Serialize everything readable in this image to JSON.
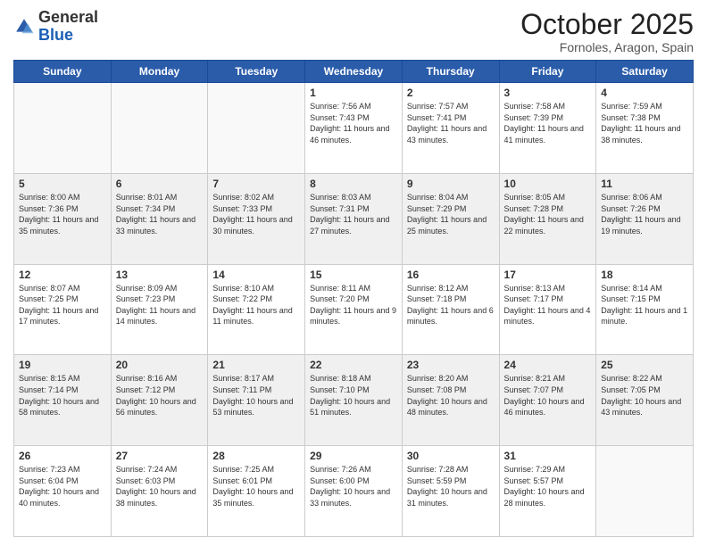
{
  "logo": {
    "general": "General",
    "blue": "Blue"
  },
  "header": {
    "month": "October 2025",
    "location": "Fornoles, Aragon, Spain"
  },
  "days_of_week": [
    "Sunday",
    "Monday",
    "Tuesday",
    "Wednesday",
    "Thursday",
    "Friday",
    "Saturday"
  ],
  "weeks": [
    [
      {
        "day": "",
        "sunrise": "",
        "sunset": "",
        "daylight": ""
      },
      {
        "day": "",
        "sunrise": "",
        "sunset": "",
        "daylight": ""
      },
      {
        "day": "",
        "sunrise": "",
        "sunset": "",
        "daylight": ""
      },
      {
        "day": "1",
        "sunrise": "Sunrise: 7:56 AM",
        "sunset": "Sunset: 7:43 PM",
        "daylight": "Daylight: 11 hours and 46 minutes."
      },
      {
        "day": "2",
        "sunrise": "Sunrise: 7:57 AM",
        "sunset": "Sunset: 7:41 PM",
        "daylight": "Daylight: 11 hours and 43 minutes."
      },
      {
        "day": "3",
        "sunrise": "Sunrise: 7:58 AM",
        "sunset": "Sunset: 7:39 PM",
        "daylight": "Daylight: 11 hours and 41 minutes."
      },
      {
        "day": "4",
        "sunrise": "Sunrise: 7:59 AM",
        "sunset": "Sunset: 7:38 PM",
        "daylight": "Daylight: 11 hours and 38 minutes."
      }
    ],
    [
      {
        "day": "5",
        "sunrise": "Sunrise: 8:00 AM",
        "sunset": "Sunset: 7:36 PM",
        "daylight": "Daylight: 11 hours and 35 minutes."
      },
      {
        "day": "6",
        "sunrise": "Sunrise: 8:01 AM",
        "sunset": "Sunset: 7:34 PM",
        "daylight": "Daylight: 11 hours and 33 minutes."
      },
      {
        "day": "7",
        "sunrise": "Sunrise: 8:02 AM",
        "sunset": "Sunset: 7:33 PM",
        "daylight": "Daylight: 11 hours and 30 minutes."
      },
      {
        "day": "8",
        "sunrise": "Sunrise: 8:03 AM",
        "sunset": "Sunset: 7:31 PM",
        "daylight": "Daylight: 11 hours and 27 minutes."
      },
      {
        "day": "9",
        "sunrise": "Sunrise: 8:04 AM",
        "sunset": "Sunset: 7:29 PM",
        "daylight": "Daylight: 11 hours and 25 minutes."
      },
      {
        "day": "10",
        "sunrise": "Sunrise: 8:05 AM",
        "sunset": "Sunset: 7:28 PM",
        "daylight": "Daylight: 11 hours and 22 minutes."
      },
      {
        "day": "11",
        "sunrise": "Sunrise: 8:06 AM",
        "sunset": "Sunset: 7:26 PM",
        "daylight": "Daylight: 11 hours and 19 minutes."
      }
    ],
    [
      {
        "day": "12",
        "sunrise": "Sunrise: 8:07 AM",
        "sunset": "Sunset: 7:25 PM",
        "daylight": "Daylight: 11 hours and 17 minutes."
      },
      {
        "day": "13",
        "sunrise": "Sunrise: 8:09 AM",
        "sunset": "Sunset: 7:23 PM",
        "daylight": "Daylight: 11 hours and 14 minutes."
      },
      {
        "day": "14",
        "sunrise": "Sunrise: 8:10 AM",
        "sunset": "Sunset: 7:22 PM",
        "daylight": "Daylight: 11 hours and 11 minutes."
      },
      {
        "day": "15",
        "sunrise": "Sunrise: 8:11 AM",
        "sunset": "Sunset: 7:20 PM",
        "daylight": "Daylight: 11 hours and 9 minutes."
      },
      {
        "day": "16",
        "sunrise": "Sunrise: 8:12 AM",
        "sunset": "Sunset: 7:18 PM",
        "daylight": "Daylight: 11 hours and 6 minutes."
      },
      {
        "day": "17",
        "sunrise": "Sunrise: 8:13 AM",
        "sunset": "Sunset: 7:17 PM",
        "daylight": "Daylight: 11 hours and 4 minutes."
      },
      {
        "day": "18",
        "sunrise": "Sunrise: 8:14 AM",
        "sunset": "Sunset: 7:15 PM",
        "daylight": "Daylight: 11 hours and 1 minute."
      }
    ],
    [
      {
        "day": "19",
        "sunrise": "Sunrise: 8:15 AM",
        "sunset": "Sunset: 7:14 PM",
        "daylight": "Daylight: 10 hours and 58 minutes."
      },
      {
        "day": "20",
        "sunrise": "Sunrise: 8:16 AM",
        "sunset": "Sunset: 7:12 PM",
        "daylight": "Daylight: 10 hours and 56 minutes."
      },
      {
        "day": "21",
        "sunrise": "Sunrise: 8:17 AM",
        "sunset": "Sunset: 7:11 PM",
        "daylight": "Daylight: 10 hours and 53 minutes."
      },
      {
        "day": "22",
        "sunrise": "Sunrise: 8:18 AM",
        "sunset": "Sunset: 7:10 PM",
        "daylight": "Daylight: 10 hours and 51 minutes."
      },
      {
        "day": "23",
        "sunrise": "Sunrise: 8:20 AM",
        "sunset": "Sunset: 7:08 PM",
        "daylight": "Daylight: 10 hours and 48 minutes."
      },
      {
        "day": "24",
        "sunrise": "Sunrise: 8:21 AM",
        "sunset": "Sunset: 7:07 PM",
        "daylight": "Daylight: 10 hours and 46 minutes."
      },
      {
        "day": "25",
        "sunrise": "Sunrise: 8:22 AM",
        "sunset": "Sunset: 7:05 PM",
        "daylight": "Daylight: 10 hours and 43 minutes."
      }
    ],
    [
      {
        "day": "26",
        "sunrise": "Sunrise: 7:23 AM",
        "sunset": "Sunset: 6:04 PM",
        "daylight": "Daylight: 10 hours and 40 minutes."
      },
      {
        "day": "27",
        "sunrise": "Sunrise: 7:24 AM",
        "sunset": "Sunset: 6:03 PM",
        "daylight": "Daylight: 10 hours and 38 minutes."
      },
      {
        "day": "28",
        "sunrise": "Sunrise: 7:25 AM",
        "sunset": "Sunset: 6:01 PM",
        "daylight": "Daylight: 10 hours and 35 minutes."
      },
      {
        "day": "29",
        "sunrise": "Sunrise: 7:26 AM",
        "sunset": "Sunset: 6:00 PM",
        "daylight": "Daylight: 10 hours and 33 minutes."
      },
      {
        "day": "30",
        "sunrise": "Sunrise: 7:28 AM",
        "sunset": "Sunset: 5:59 PM",
        "daylight": "Daylight: 10 hours and 31 minutes."
      },
      {
        "day": "31",
        "sunrise": "Sunrise: 7:29 AM",
        "sunset": "Sunset: 5:57 PM",
        "daylight": "Daylight: 10 hours and 28 minutes."
      },
      {
        "day": "",
        "sunrise": "",
        "sunset": "",
        "daylight": ""
      }
    ]
  ]
}
